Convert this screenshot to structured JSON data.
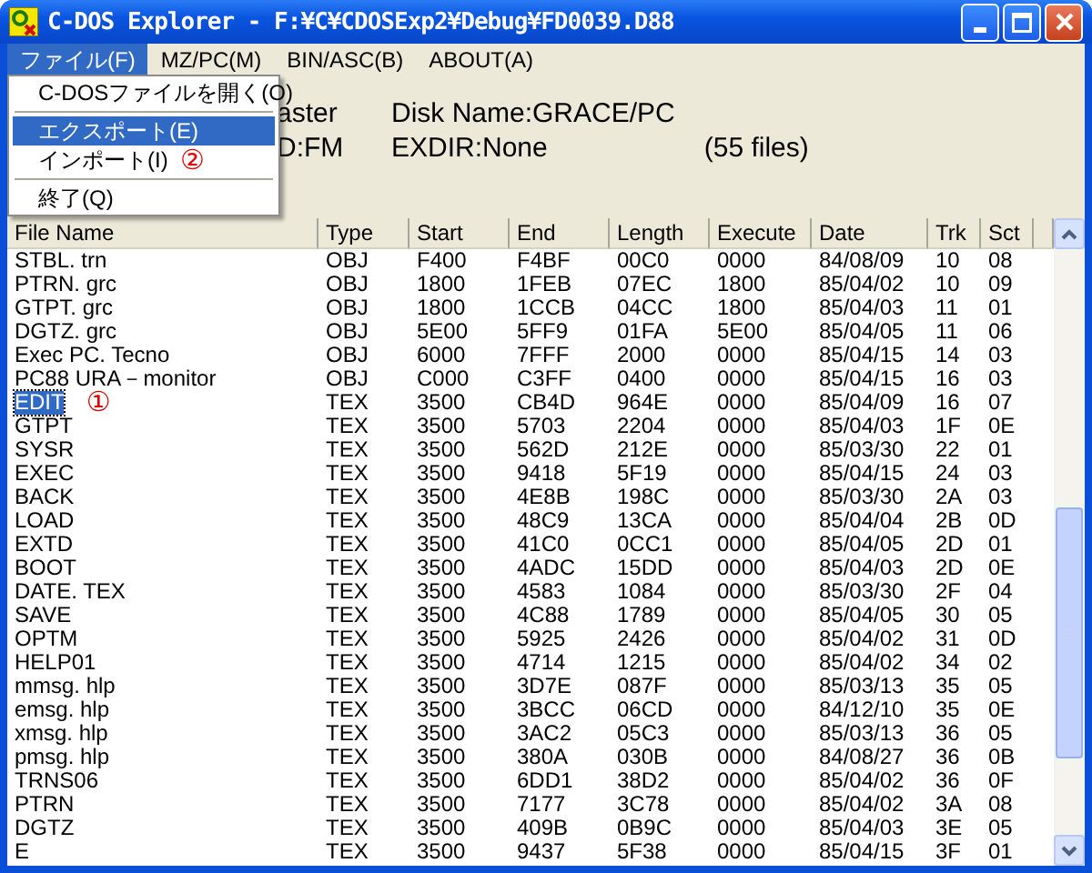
{
  "window": {
    "title": "C-DOS Explorer - F:¥C¥CDOSExp2¥Debug¥FD0039.D88"
  },
  "menu_bar": [
    {
      "label": "ファイル(F)",
      "selected": true
    },
    {
      "label": "MZ/PC(M)",
      "selected": false
    },
    {
      "label": "BIN/ASC(B)",
      "selected": false
    },
    {
      "label": "ABOUT(A)",
      "selected": false
    }
  ],
  "dropdown": [
    {
      "kind": "item",
      "label": "C-DOSファイルを開く(O)",
      "selected": false
    },
    {
      "kind": "separator"
    },
    {
      "kind": "item",
      "label": "エクスポート(E)",
      "selected": true
    },
    {
      "kind": "item",
      "label": "インポート(I)",
      "selected": false,
      "marker": "②"
    },
    {
      "kind": "separator"
    },
    {
      "kind": "item",
      "label": "終了(Q)",
      "selected": false
    }
  ],
  "info": {
    "line_1": [
      "aster",
      "Disk Name:GRACE/PC"
    ],
    "line_2": [
      "D:FM",
      "EXDIR:None",
      "(55 files)"
    ]
  },
  "table": {
    "columns": [
      "File Name",
      "Type",
      "Start",
      "End",
      "Length",
      "Execute",
      "Date",
      "Trk",
      "Sct"
    ],
    "rows": [
      {
        "cells": [
          "STBL. trn",
          "OBJ",
          "F400",
          "F4BF",
          "00C0",
          "0000",
          "84/08/09",
          "10",
          "08"
        ],
        "selected": false
      },
      {
        "cells": [
          "PTRN. grc",
          "OBJ",
          "1800",
          "1FEB",
          "07EC",
          "1800",
          "85/04/02",
          "10",
          "09"
        ],
        "selected": false
      },
      {
        "cells": [
          "GTPT. grc",
          "OBJ",
          "1800",
          "1CCB",
          "04CC",
          "1800",
          "85/04/03",
          "11",
          "01"
        ],
        "selected": false
      },
      {
        "cells": [
          "DGTZ. grc",
          "OBJ",
          "5E00",
          "5FF9",
          "01FA",
          "5E00",
          "85/04/05",
          "11",
          "06"
        ],
        "selected": false
      },
      {
        "cells": [
          "Exec  PC. Tecno",
          "OBJ",
          "6000",
          "7FFF",
          "2000",
          "0000",
          "85/04/15",
          "14",
          "03"
        ],
        "selected": false
      },
      {
        "cells": [
          "PC88  URA－monitor",
          "OBJ",
          "C000",
          "C3FF",
          "0400",
          "0000",
          "85/04/15",
          "16",
          "03"
        ],
        "selected": false
      },
      {
        "cells": [
          "EDIT",
          "TEX",
          "3500",
          "CB4D",
          "964E",
          "0000",
          "85/04/09",
          "16",
          "07"
        ],
        "selected": true,
        "marker": "①"
      },
      {
        "cells": [
          "GTPT",
          "TEX",
          "3500",
          "5703",
          "2204",
          "0000",
          "85/04/03",
          "1F",
          "0E"
        ],
        "selected": false
      },
      {
        "cells": [
          "SYSR",
          "TEX",
          "3500",
          "562D",
          "212E",
          "0000",
          "85/03/30",
          "22",
          "01"
        ],
        "selected": false
      },
      {
        "cells": [
          "EXEC",
          "TEX",
          "3500",
          "9418",
          "5F19",
          "0000",
          "85/04/15",
          "24",
          "03"
        ],
        "selected": false
      },
      {
        "cells": [
          "BACK",
          "TEX",
          "3500",
          "4E8B",
          "198C",
          "0000",
          "85/03/30",
          "2A",
          "03"
        ],
        "selected": false
      },
      {
        "cells": [
          "LOAD",
          "TEX",
          "3500",
          "48C9",
          "13CA",
          "0000",
          "85/04/04",
          "2B",
          "0D"
        ],
        "selected": false
      },
      {
        "cells": [
          "EXTD",
          "TEX",
          "3500",
          "41C0",
          "0CC1",
          "0000",
          "85/04/05",
          "2D",
          "01"
        ],
        "selected": false
      },
      {
        "cells": [
          "BOOT",
          "TEX",
          "3500",
          "4ADC",
          "15DD",
          "0000",
          "85/04/03",
          "2D",
          "0E"
        ],
        "selected": false
      },
      {
        "cells": [
          "DATE. TEX",
          "TEX",
          "3500",
          "4583",
          "1084",
          "0000",
          "85/03/30",
          "2F",
          "04"
        ],
        "selected": false
      },
      {
        "cells": [
          "SAVE",
          "TEX",
          "3500",
          "4C88",
          "1789",
          "0000",
          "85/04/05",
          "30",
          "05"
        ],
        "selected": false
      },
      {
        "cells": [
          "OPTM",
          "TEX",
          "3500",
          "5925",
          "2426",
          "0000",
          "85/04/02",
          "31",
          "0D"
        ],
        "selected": false
      },
      {
        "cells": [
          "HELP01",
          "TEX",
          "3500",
          "4714",
          "1215",
          "0000",
          "85/04/02",
          "34",
          "02"
        ],
        "selected": false
      },
      {
        "cells": [
          "mmsg. hlp",
          "TEX",
          "3500",
          "3D7E",
          "087F",
          "0000",
          "85/03/13",
          "35",
          "05"
        ],
        "selected": false
      },
      {
        "cells": [
          "emsg. hlp",
          "TEX",
          "3500",
          "3BCC",
          "06CD",
          "0000",
          "84/12/10",
          "35",
          "0E"
        ],
        "selected": false
      },
      {
        "cells": [
          "xmsg. hlp",
          "TEX",
          "3500",
          "3AC2",
          "05C3",
          "0000",
          "85/03/13",
          "36",
          "05"
        ],
        "selected": false
      },
      {
        "cells": [
          "pmsg. hlp",
          "TEX",
          "3500",
          "380A",
          "030B",
          "0000",
          "84/08/27",
          "36",
          "0B"
        ],
        "selected": false
      },
      {
        "cells": [
          "TRNS06",
          "TEX",
          "3500",
          "6DD1",
          "38D2",
          "0000",
          "85/04/02",
          "36",
          "0F"
        ],
        "selected": false
      },
      {
        "cells": [
          "PTRN",
          "TEX",
          "3500",
          "7177",
          "3C78",
          "0000",
          "85/04/02",
          "3A",
          "08"
        ],
        "selected": false
      },
      {
        "cells": [
          "DGTZ",
          "TEX",
          "3500",
          "409B",
          "0B9C",
          "0000",
          "85/04/03",
          "3E",
          "05"
        ],
        "selected": false
      },
      {
        "cells": [
          "E",
          "TEX",
          "3500",
          "9437",
          "5F38",
          "0000",
          "85/04/15",
          "3F",
          "01"
        ],
        "selected": false
      }
    ]
  }
}
